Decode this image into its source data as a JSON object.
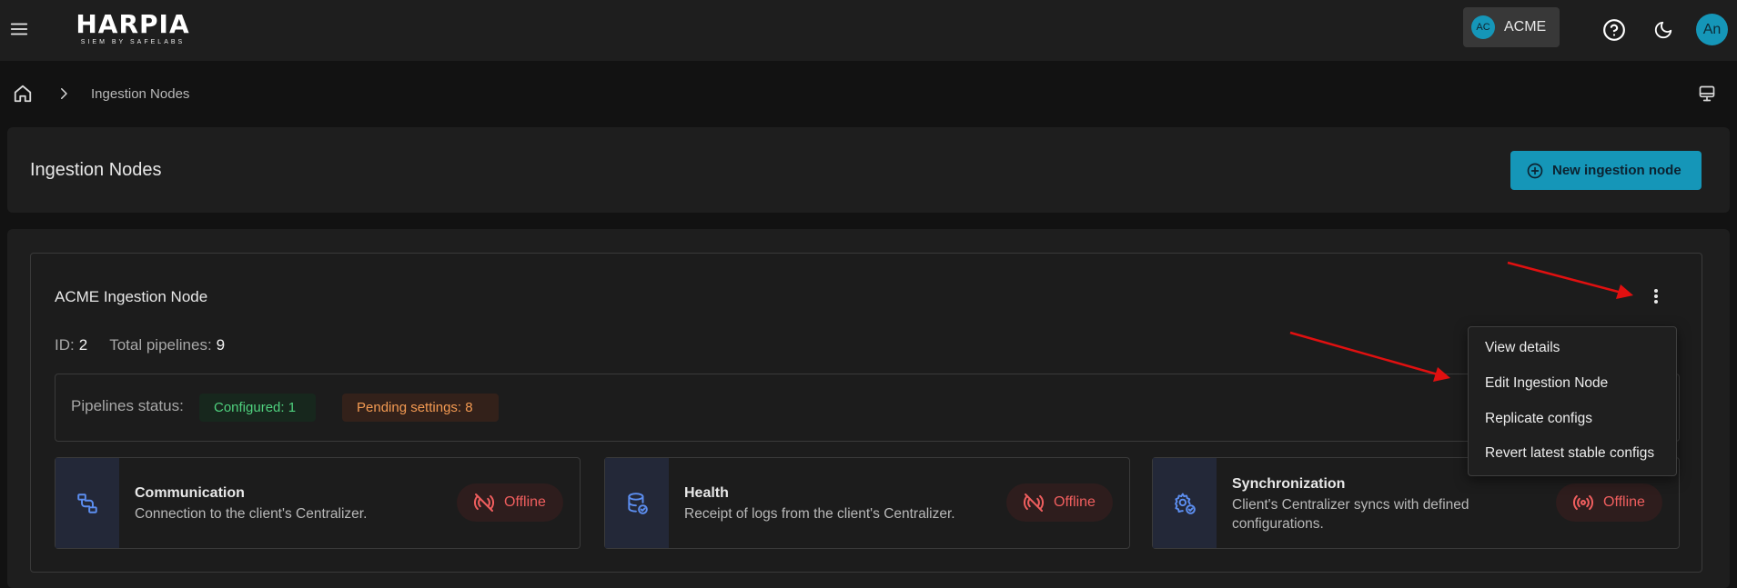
{
  "topbar": {
    "logo_text": "HARPIA",
    "logo_subtitle": "SIEM BY SAFELABS",
    "org_initials": "AC",
    "org_name": "ACME",
    "user_initials": "An"
  },
  "breadcrumb": {
    "current": "Ingestion Nodes"
  },
  "header": {
    "title": "Ingestion Nodes",
    "new_button_label": "New ingestion node"
  },
  "node": {
    "title": "ACME Ingestion Node",
    "id_label": "ID:",
    "id_value": "2",
    "pipelines_label": "Total pipelines:",
    "pipelines_value": "9",
    "pipelines_status_label": "Pipelines status:",
    "configured_chip": "Configured: 1",
    "pending_chip": "Pending settings: 8"
  },
  "status_cards": [
    {
      "title": "Communication",
      "description": "Connection to the client's Centralizer.",
      "status": "Offline"
    },
    {
      "title": "Health",
      "description": "Receipt of logs from the client's Centralizer.",
      "status": "Offline"
    },
    {
      "title": "Synchronization",
      "description": "Client's Centralizer syncs with defined configurations.",
      "status": "Offline"
    }
  ],
  "menu": {
    "items": [
      "View details",
      "Edit Ingestion Node",
      "Replicate configs",
      "Revert latest stable configs"
    ]
  },
  "colors": {
    "accent": "#1596b8",
    "configured": "#4fd17e",
    "pending": "#f39a52",
    "offline": "#ef5e5e",
    "annotation_arrow": "#e01010"
  },
  "icons": [
    "menu-icon",
    "help-icon",
    "moon-icon",
    "home-icon",
    "chevron-right-icon",
    "monitor-icon",
    "plus-circle-icon",
    "more-vertical-icon",
    "connection-icon",
    "database-icon",
    "settings-sync-icon",
    "signal-off-icon",
    "signal-icon"
  ]
}
